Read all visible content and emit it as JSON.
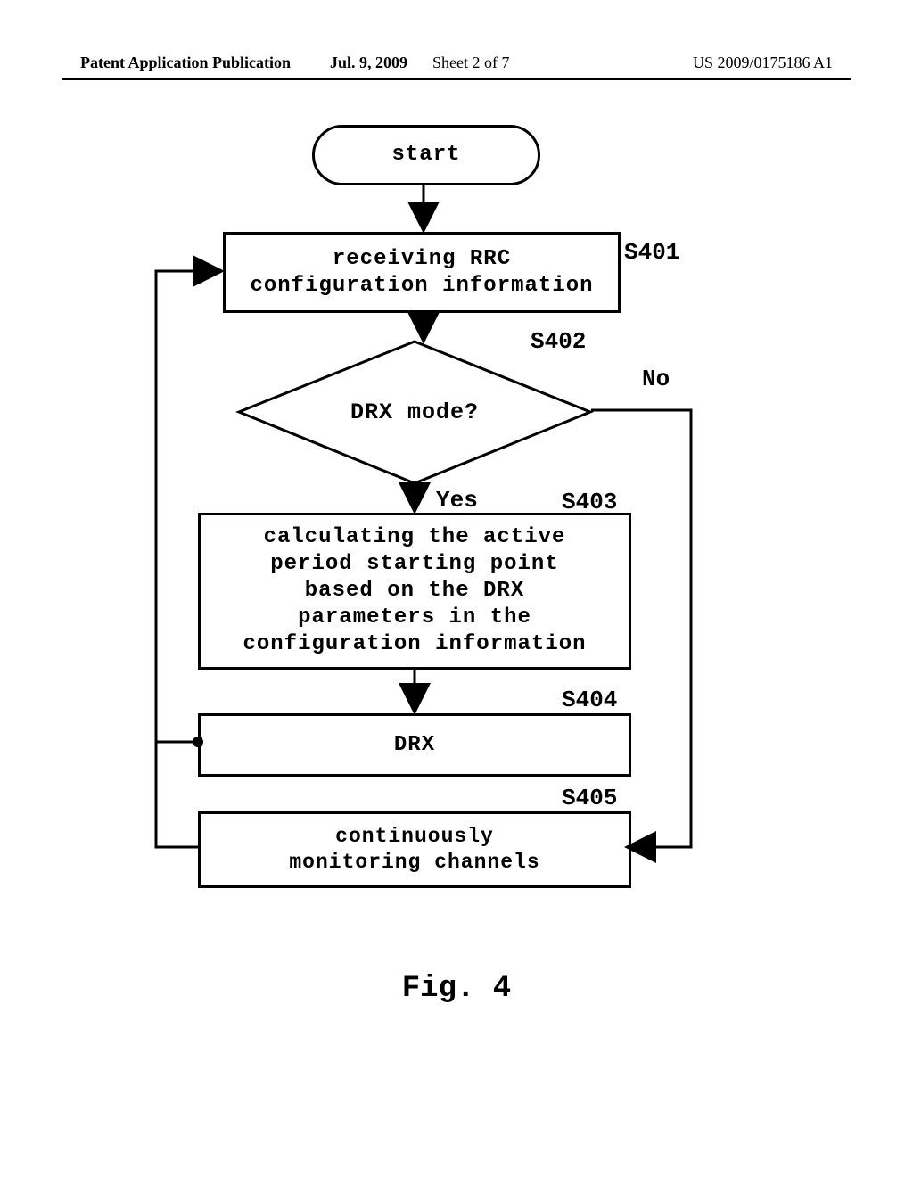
{
  "header": {
    "left": "Patent Application Publication",
    "date": "Jul. 9, 2009",
    "sheet": "Sheet 2 of 7",
    "pubno": "US 2009/0175186 A1"
  },
  "flow": {
    "start": "start",
    "s401": {
      "label": "S401",
      "text": "receiving RRC\nconfiguration information"
    },
    "s402": {
      "label": "S402",
      "text": "DRX mode?",
      "yes": "Yes",
      "no": "No"
    },
    "s403": {
      "label": "S403",
      "text": "calculating the active\nperiod starting point\nbased on the DRX\nparameters in the\nconfiguration information"
    },
    "s404": {
      "label": "S404",
      "text": "DRX"
    },
    "s405": {
      "label": "S405",
      "text": "continuously\nmonitoring channels"
    },
    "figure": "Fig. 4"
  }
}
